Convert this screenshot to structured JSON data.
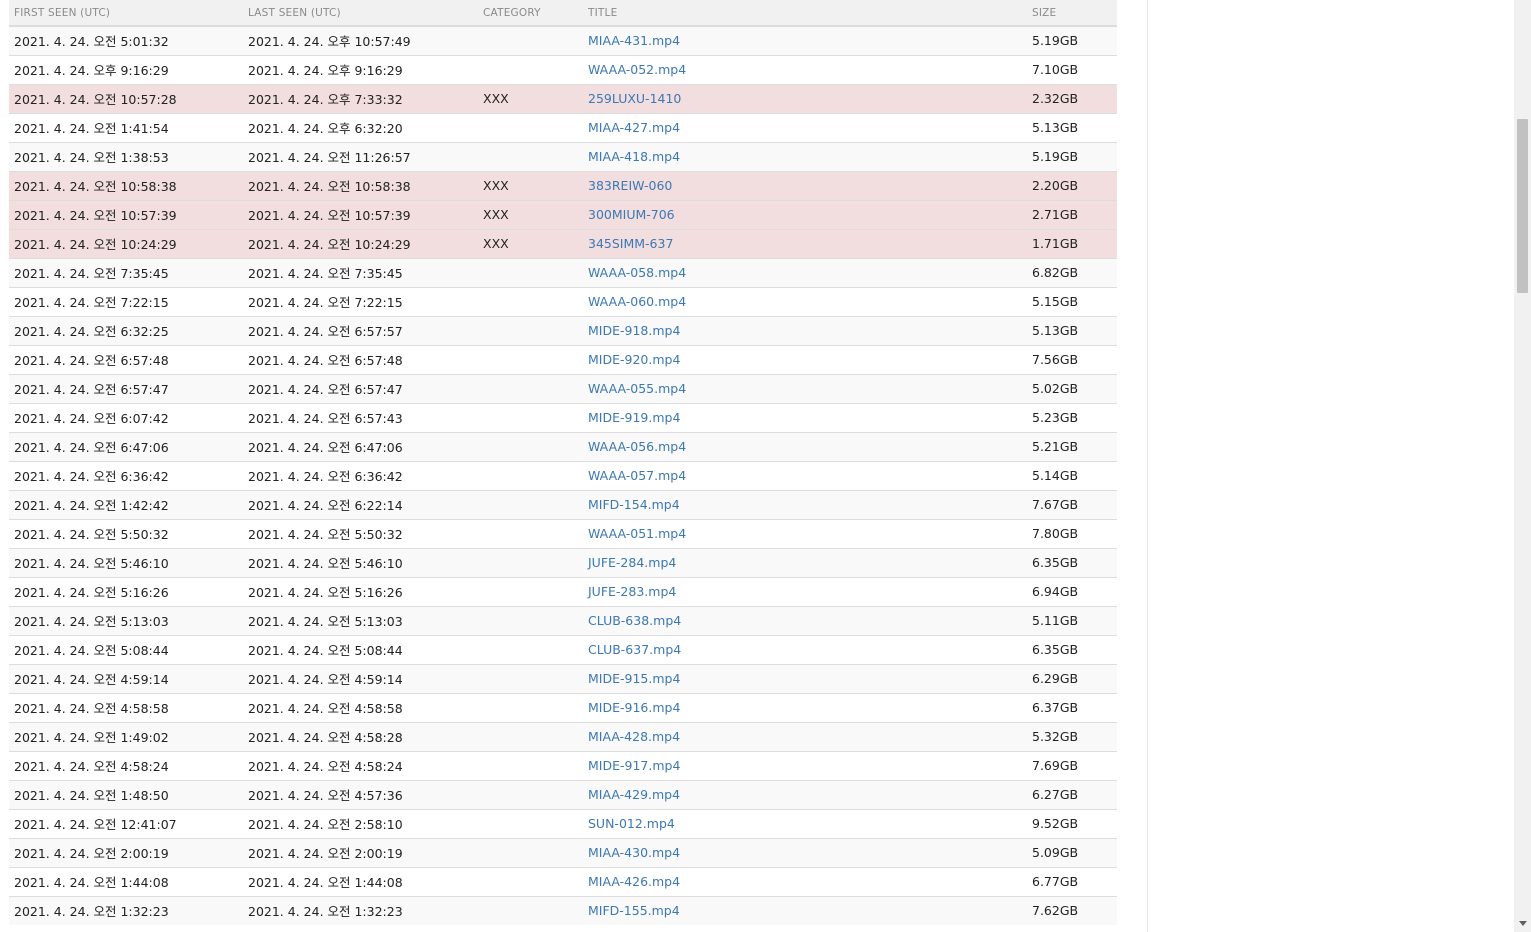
{
  "table": {
    "headers": {
      "first_seen": "FIRST SEEN (UTC)",
      "last_seen": "LAST SEEN (UTC)",
      "category": "CATEGORY",
      "title": "TITLE",
      "size": "SIZE"
    },
    "rows": [
      {
        "first": "2021. 4. 24. 오전 5:01:32",
        "last": "2021. 4. 24. 오후 10:57:49",
        "category": "",
        "title": "MIAA-431.mp4",
        "size": "5.19GB",
        "highlight": false
      },
      {
        "first": "2021. 4. 24. 오후 9:16:29",
        "last": "2021. 4. 24. 오후 9:16:29",
        "category": "",
        "title": "WAAA-052.mp4",
        "size": "7.10GB",
        "highlight": false
      },
      {
        "first": "2021. 4. 24. 오전 10:57:28",
        "last": "2021. 4. 24. 오후 7:33:32",
        "category": "XXX",
        "title": "259LUXU-1410",
        "size": "2.32GB",
        "highlight": true
      },
      {
        "first": "2021. 4. 24. 오전 1:41:54",
        "last": "2021. 4. 24. 오후 6:32:20",
        "category": "",
        "title": "MIAA-427.mp4",
        "size": "5.13GB",
        "highlight": false
      },
      {
        "first": "2021. 4. 24. 오전 1:38:53",
        "last": "2021. 4. 24. 오전 11:26:57",
        "category": "",
        "title": "MIAA-418.mp4",
        "size": "5.19GB",
        "highlight": false
      },
      {
        "first": "2021. 4. 24. 오전 10:58:38",
        "last": "2021. 4. 24. 오전 10:58:38",
        "category": "XXX",
        "title": "383REIW-060",
        "size": "2.20GB",
        "highlight": true
      },
      {
        "first": "2021. 4. 24. 오전 10:57:39",
        "last": "2021. 4. 24. 오전 10:57:39",
        "category": "XXX",
        "title": "300MIUM-706",
        "size": "2.71GB",
        "highlight": true
      },
      {
        "first": "2021. 4. 24. 오전 10:24:29",
        "last": "2021. 4. 24. 오전 10:24:29",
        "category": "XXX",
        "title": "345SIMM-637",
        "size": "1.71GB",
        "highlight": true
      },
      {
        "first": "2021. 4. 24. 오전 7:35:45",
        "last": "2021. 4. 24. 오전 7:35:45",
        "category": "",
        "title": "WAAA-058.mp4",
        "size": "6.82GB",
        "highlight": false
      },
      {
        "first": "2021. 4. 24. 오전 7:22:15",
        "last": "2021. 4. 24. 오전 7:22:15",
        "category": "",
        "title": "WAAA-060.mp4",
        "size": "5.15GB",
        "highlight": false
      },
      {
        "first": "2021. 4. 24. 오전 6:32:25",
        "last": "2021. 4. 24. 오전 6:57:57",
        "category": "",
        "title": "MIDE-918.mp4",
        "size": "5.13GB",
        "highlight": false
      },
      {
        "first": "2021. 4. 24. 오전 6:57:48",
        "last": "2021. 4. 24. 오전 6:57:48",
        "category": "",
        "title": "MIDE-920.mp4",
        "size": "7.56GB",
        "highlight": false
      },
      {
        "first": "2021. 4. 24. 오전 6:57:47",
        "last": "2021. 4. 24. 오전 6:57:47",
        "category": "",
        "title": "WAAA-055.mp4",
        "size": "5.02GB",
        "highlight": false
      },
      {
        "first": "2021. 4. 24. 오전 6:07:42",
        "last": "2021. 4. 24. 오전 6:57:43",
        "category": "",
        "title": "MIDE-919.mp4",
        "size": "5.23GB",
        "highlight": false
      },
      {
        "first": "2021. 4. 24. 오전 6:47:06",
        "last": "2021. 4. 24. 오전 6:47:06",
        "category": "",
        "title": "WAAA-056.mp4",
        "size": "5.21GB",
        "highlight": false
      },
      {
        "first": "2021. 4. 24. 오전 6:36:42",
        "last": "2021. 4. 24. 오전 6:36:42",
        "category": "",
        "title": "WAAA-057.mp4",
        "size": "5.14GB",
        "highlight": false
      },
      {
        "first": "2021. 4. 24. 오전 1:42:42",
        "last": "2021. 4. 24. 오전 6:22:14",
        "category": "",
        "title": "MIFD-154.mp4",
        "size": "7.67GB",
        "highlight": false
      },
      {
        "first": "2021. 4. 24. 오전 5:50:32",
        "last": "2021. 4. 24. 오전 5:50:32",
        "category": "",
        "title": "WAAA-051.mp4",
        "size": "7.80GB",
        "highlight": false
      },
      {
        "first": "2021. 4. 24. 오전 5:46:10",
        "last": "2021. 4. 24. 오전 5:46:10",
        "category": "",
        "title": "JUFE-284.mp4",
        "size": "6.35GB",
        "highlight": false
      },
      {
        "first": "2021. 4. 24. 오전 5:16:26",
        "last": "2021. 4. 24. 오전 5:16:26",
        "category": "",
        "title": "JUFE-283.mp4",
        "size": "6.94GB",
        "highlight": false
      },
      {
        "first": "2021. 4. 24. 오전 5:13:03",
        "last": "2021. 4. 24. 오전 5:13:03",
        "category": "",
        "title": "CLUB-638.mp4",
        "size": "5.11GB",
        "highlight": false
      },
      {
        "first": "2021. 4. 24. 오전 5:08:44",
        "last": "2021. 4. 24. 오전 5:08:44",
        "category": "",
        "title": "CLUB-637.mp4",
        "size": "6.35GB",
        "highlight": false
      },
      {
        "first": "2021. 4. 24. 오전 4:59:14",
        "last": "2021. 4. 24. 오전 4:59:14",
        "category": "",
        "title": "MIDE-915.mp4",
        "size": "6.29GB",
        "highlight": false
      },
      {
        "first": "2021. 4. 24. 오전 4:58:58",
        "last": "2021. 4. 24. 오전 4:58:58",
        "category": "",
        "title": "MIDE-916.mp4",
        "size": "6.37GB",
        "highlight": false
      },
      {
        "first": "2021. 4. 24. 오전 1:49:02",
        "last": "2021. 4. 24. 오전 4:58:28",
        "category": "",
        "title": "MIAA-428.mp4",
        "size": "5.32GB",
        "highlight": false
      },
      {
        "first": "2021. 4. 24. 오전 4:58:24",
        "last": "2021. 4. 24. 오전 4:58:24",
        "category": "",
        "title": "MIDE-917.mp4",
        "size": "7.69GB",
        "highlight": false
      },
      {
        "first": "2021. 4. 24. 오전 1:48:50",
        "last": "2021. 4. 24. 오전 4:57:36",
        "category": "",
        "title": "MIAA-429.mp4",
        "size": "6.27GB",
        "highlight": false
      },
      {
        "first": "2021. 4. 24. 오전 12:41:07",
        "last": "2021. 4. 24. 오전 2:58:10",
        "category": "",
        "title": "SUN-012.mp4",
        "size": "9.52GB",
        "highlight": false
      },
      {
        "first": "2021. 4. 24. 오전 2:00:19",
        "last": "2021. 4. 24. 오전 2:00:19",
        "category": "",
        "title": "MIAA-430.mp4",
        "size": "5.09GB",
        "highlight": false
      },
      {
        "first": "2021. 4. 24. 오전 1:44:08",
        "last": "2021. 4. 24. 오전 1:44:08",
        "category": "",
        "title": "MIAA-426.mp4",
        "size": "6.77GB",
        "highlight": false
      },
      {
        "first": "2021. 4. 24. 오전 1:32:23",
        "last": "2021. 4. 24. 오전 1:32:23",
        "category": "",
        "title": "MIFD-155.mp4",
        "size": "7.62GB",
        "highlight": false
      }
    ]
  },
  "colors": {
    "link": "#3c78b4",
    "highlight_row": "#f2dede",
    "header_bg": "#f1f1f1",
    "header_text": "#8a8a8a"
  },
  "scrollbar": {
    "scroll_position": 0.13,
    "visible_fraction": 0.19
  }
}
